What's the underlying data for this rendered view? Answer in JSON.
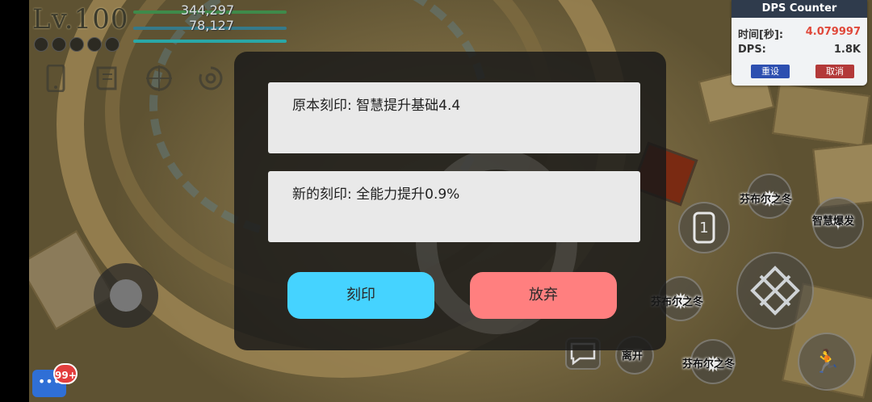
{
  "hud": {
    "level": "Lv.100",
    "hp_value": "344,297",
    "mp_value": "78,127",
    "menu_icons": [
      "phone-icon",
      "scroll-icon",
      "crosshair-icon",
      "swirl-icon"
    ]
  },
  "dps_counter": {
    "title": "DPS Counter",
    "time_label": "时间[秒]:",
    "time_value": "4.079997",
    "dps_label": "DPS:",
    "dps_value": "1.8K",
    "reset_label": "重设",
    "cancel_label": "取消"
  },
  "dialog": {
    "original_engraving": "原本刻印: 智慧提升基础4.4",
    "new_engraving": "新的刻印: 全能力提升0.9%",
    "engrave_button": "刻印",
    "abandon_button": "放弃"
  },
  "skills": {
    "skill_a_label": "芬布尔之冬",
    "skill_b_label": "智慧爆发",
    "skill_c_label": "芬布尔之冬",
    "skill_d_label": "芬布尔之冬",
    "leave_label": "离开",
    "slot_number": "1"
  },
  "chat": {
    "badge": "99+"
  },
  "colors": {
    "engrave_button": "#45d3ff",
    "abandon_button": "#ff7f7f",
    "dps_header": "#2f3b4c",
    "dps_time": "#e0483a",
    "reset_button": "#2d4fb0",
    "cancel_button": "#b33939"
  }
}
